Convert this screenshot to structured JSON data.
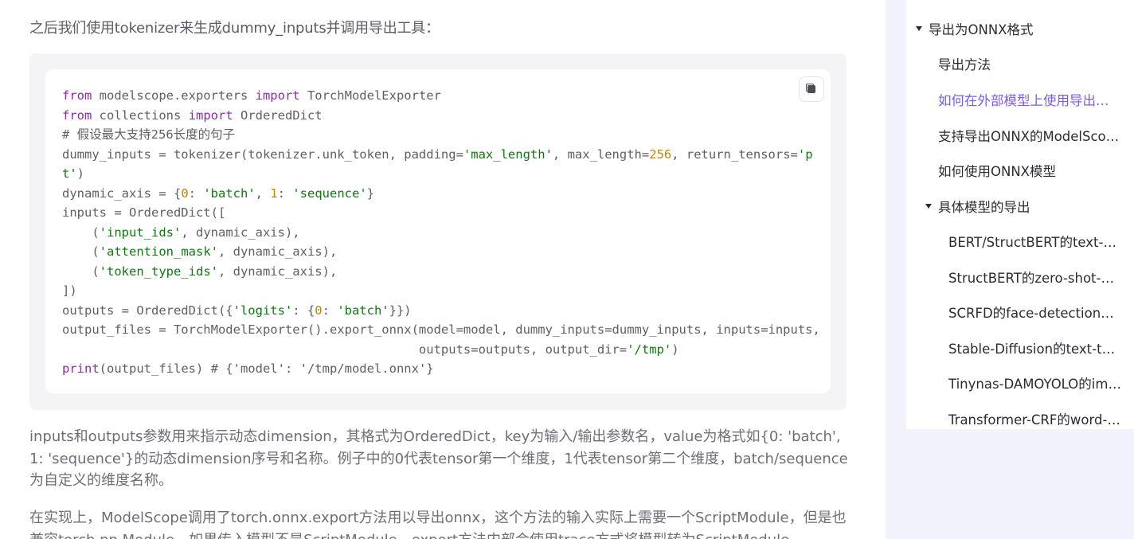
{
  "intro_text": "之后我们使用tokenizer来生成dummy_inputs并调用导出工具：",
  "code_lines": [
    [
      [
        "kw",
        "from"
      ],
      [
        "t",
        " modelscope.exporters "
      ],
      [
        "kw",
        "import"
      ],
      [
        "t",
        " TorchModelExporter"
      ]
    ],
    [
      [
        "kw",
        "from"
      ],
      [
        "t",
        " collections "
      ],
      [
        "kw",
        "import"
      ],
      [
        "t",
        " OrderedDict"
      ]
    ],
    [
      [
        "cm",
        "# 假设最大支持256长度的句子"
      ]
    ],
    [
      [
        "t",
        "dummy_inputs = tokenizer(tokenizer.unk_token, padding="
      ],
      [
        "str",
        "'max_length'"
      ],
      [
        "t",
        ", max_length="
      ],
      [
        "num",
        "256"
      ],
      [
        "t",
        ", return_tensors="
      ],
      [
        "str",
        "'p"
      ]
    ],
    [
      [
        "str",
        "t'"
      ],
      [
        "t",
        ")"
      ]
    ],
    [
      [
        "t",
        "dynamic_axis = {"
      ],
      [
        "num",
        "0"
      ],
      [
        "t",
        ": "
      ],
      [
        "str",
        "'batch'"
      ],
      [
        "t",
        ", "
      ],
      [
        "num",
        "1"
      ],
      [
        "t",
        ": "
      ],
      [
        "str",
        "'sequence'"
      ],
      [
        "t",
        "}"
      ]
    ],
    [
      [
        "t",
        "inputs = OrderedDict(["
      ]
    ],
    [
      [
        "t",
        "    ("
      ],
      [
        "str",
        "'input_ids'"
      ],
      [
        "t",
        ", dynamic_axis),"
      ]
    ],
    [
      [
        "t",
        "    ("
      ],
      [
        "str",
        "'attention_mask'"
      ],
      [
        "t",
        ", dynamic_axis),"
      ]
    ],
    [
      [
        "t",
        "    ("
      ],
      [
        "str",
        "'token_type_ids'"
      ],
      [
        "t",
        ", dynamic_axis),"
      ]
    ],
    [
      [
        "t",
        "])"
      ]
    ],
    [
      [
        "t",
        "outputs = OrderedDict({"
      ],
      [
        "str",
        "'logits'"
      ],
      [
        "t",
        ": {"
      ],
      [
        "num",
        "0"
      ],
      [
        "t",
        ": "
      ],
      [
        "str",
        "'batch'"
      ],
      [
        "t",
        "}})"
      ]
    ],
    [
      [
        "t",
        "output_files = TorchModelExporter().export_onnx(model=model, dummy_inputs=dummy_inputs, inputs=inputs,"
      ]
    ],
    [
      [
        "t",
        "                                                outputs=outputs, output_dir="
      ],
      [
        "str",
        "'/tmp'"
      ],
      [
        "t",
        ")"
      ]
    ],
    [
      [
        "kw",
        "print"
      ],
      [
        "t",
        "(output_files) # {'model': '/tmp/model.onnx'}"
      ]
    ]
  ],
  "paragraphs": [
    "inputs和outputs参数用来指示动态dimension，其格式为OrderedDict，key为输入/输出参数名，value为格式如{0: 'batch', 1: 'sequence'}的动态dimension序号和名称。例子中的0代表tensor第一个维度，1代表tensor第二个维度，batch/sequence为自定义的维度名称。",
    "在实现上，ModelScope调用了torch.onnx.export方法用以导出onnx，这个方法的输入实际上需要一个ScriptModule，但是也兼容torch.nn.Module。如果传入模型不是ScriptModule，export方法内部会使用trace方式将模型转为ScriptModule。"
  ],
  "toc": {
    "section": "导出为ONNX格式",
    "items": [
      {
        "label": "导出方法"
      },
      {
        "label": "如何在外部模型上使用导出工具",
        "active": true
      },
      {
        "label": "支持导出ONNX的ModelScope模型"
      },
      {
        "label": "如何使用ONNX模型"
      }
    ],
    "subsection": "具体模型的导出",
    "subitems": [
      {
        "label": "BERT/StructBERT的text-classification"
      },
      {
        "label": "StructBERT的zero-shot-classification"
      },
      {
        "label": "SCRFD的face-detection模型"
      },
      {
        "label": "Stable-Diffusion的text-to-image模型"
      },
      {
        "label": "Tinynas-DAMOYOLO的image-object-detection"
      },
      {
        "label": "Transformer-CRF的word-segmentation"
      }
    ]
  },
  "colors": {
    "accent": "#7b5cf0",
    "keyword": "#8a2ba8",
    "string": "#0f7a0f",
    "number": "#b8860b"
  }
}
